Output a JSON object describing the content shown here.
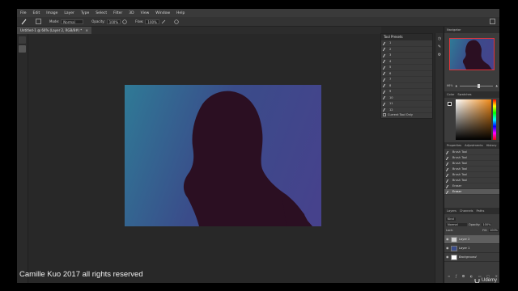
{
  "menu": [
    "File",
    "Edit",
    "Image",
    "Layer",
    "Type",
    "Select",
    "Filter",
    "3D",
    "View",
    "Window",
    "Help"
  ],
  "options": {
    "mode_label": "Mode:",
    "mode_value": "Normal",
    "opacity_label": "Opacity:",
    "opacity_value": "100%",
    "flow_label": "Flow:",
    "flow_value": "100%"
  },
  "document_tab": "Untitled-1 @ 66% (Layer 2, RGB/8#) *",
  "tool_presets": {
    "title": "Tool Presets",
    "items": [
      "1",
      "2",
      "3",
      "4",
      "5",
      "6",
      "7",
      "8",
      "9",
      "10",
      "11",
      "12",
      "13",
      "14",
      "15"
    ],
    "current_tool_only": "Current Tool Only"
  },
  "navigator": {
    "tabs": [
      "Navigator"
    ],
    "zoom": "66%"
  },
  "color": {
    "tabs": [
      "Color",
      "Swatches"
    ],
    "accent": "#f08a18"
  },
  "history": {
    "tabs": [
      "Properties",
      "Adjustments",
      "History"
    ],
    "items": [
      "Brush Tool",
      "Brush Tool",
      "Brush Tool",
      "Brush Tool",
      "Brush Tool",
      "Brush Tool",
      "Eraser",
      "Eraser"
    ]
  },
  "layers": {
    "tabs": [
      "Layers",
      "Channels",
      "Paths"
    ],
    "filter_kind": "Kind",
    "blend_mode": "Normal",
    "opacity_label": "Opacity:",
    "opacity_value": "100%",
    "lock_label": "Lock:",
    "fill_label": "Fill:",
    "fill_value": "100%",
    "rows": [
      {
        "name": "Layer 2",
        "selected": true
      },
      {
        "name": "Layer 1",
        "selected": false
      },
      {
        "name": "Background",
        "selected": false
      }
    ]
  },
  "watermark": "Camille Kuo 2017 all rights reserved",
  "brand": "Udemy"
}
